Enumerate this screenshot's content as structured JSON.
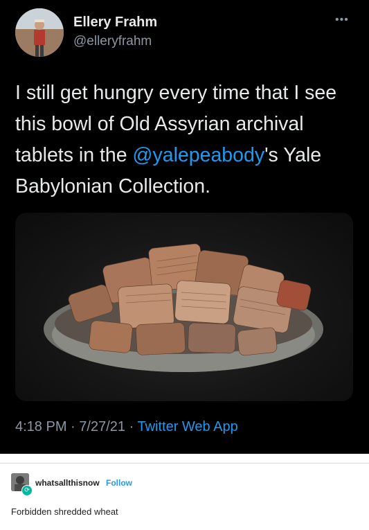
{
  "tweet": {
    "author_name": "Ellery Frahm",
    "author_handle": "@elleryfrahm",
    "more_icon": "more-horizontal-icon",
    "text_before": "I still get hungry every time that I see this bowl of Old Assyrian archival tablets in the ",
    "mention": "@yalepeabody",
    "text_after": "'s Yale Babylonian Collection.",
    "time": "4:18 PM",
    "date": "7/27/21",
    "separator": "·",
    "source": "Twitter Web App",
    "colors": {
      "background": "#000000",
      "text": "#e7e9ea",
      "secondary": "#8b98a5",
      "link": "#1d9bf0"
    }
  },
  "reblog": {
    "username": "whatsallthisnow",
    "follow_label": "Follow",
    "comment": "Forbidden shredded wheat",
    "colors": {
      "follow": "#1d9bf0",
      "badge": "#00b8a0"
    }
  }
}
